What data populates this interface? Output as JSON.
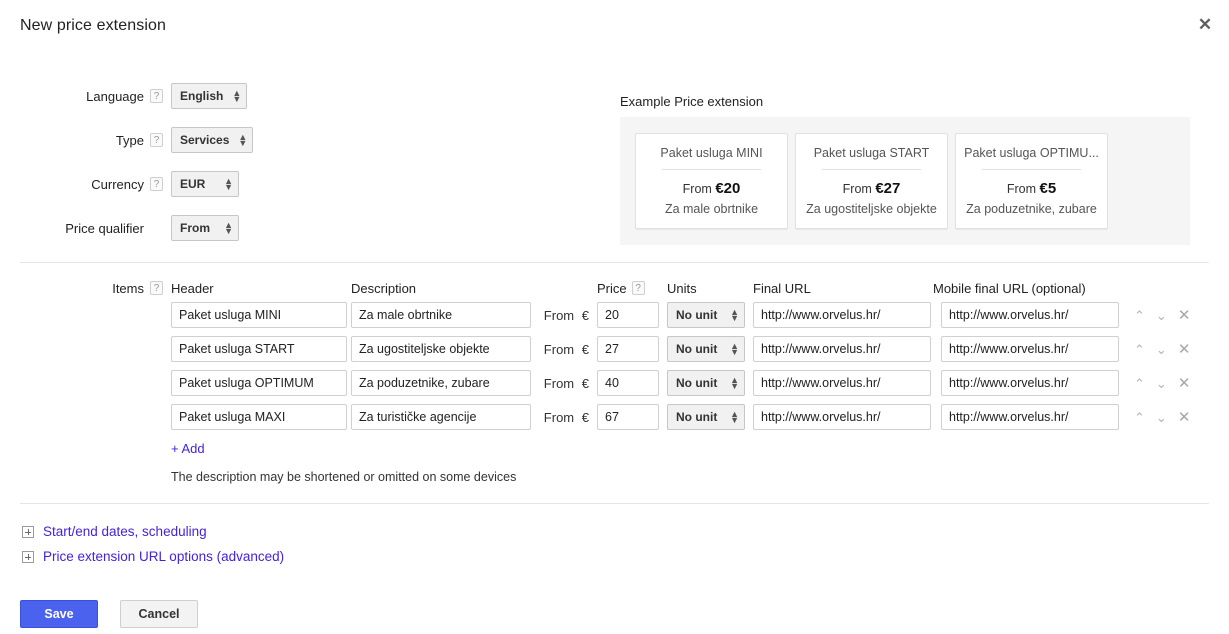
{
  "dialog": {
    "title": "New price extension",
    "close_icon": "close-icon",
    "close_glyph": "✕"
  },
  "form": {
    "rows": [
      {
        "label": "Language",
        "help": "?",
        "value": "English",
        "has_help": true
      },
      {
        "label": "Type",
        "help": "?",
        "value": "Services",
        "has_help": true
      },
      {
        "label": "Currency",
        "help": "?",
        "value": "EUR",
        "has_help": true
      },
      {
        "label": "Price qualifier",
        "help": "",
        "value": "From",
        "has_help": false
      }
    ]
  },
  "example": {
    "title": "Example Price extension",
    "cards": [
      {
        "header": "Paket usluga MINI",
        "qualifier": "From",
        "price": "€20",
        "desc": "Za male obrtnike"
      },
      {
        "header": "Paket usluga START",
        "qualifier": "From",
        "price": "€27",
        "desc": "Za ugostiteljske objekte"
      },
      {
        "header": "Paket usluga OPTIMU...",
        "qualifier": "From",
        "price": "€5",
        "desc": "Za poduzetnike, zubare"
      }
    ]
  },
  "items": {
    "label": "Items",
    "help": "?",
    "columns": {
      "header": "Header",
      "description": "Description",
      "price": "Price",
      "price_help": "?",
      "units": "Units",
      "final_url": "Final URL",
      "mobile_final_url": "Mobile final URL (optional)"
    },
    "rows": [
      {
        "header": "Paket usluga MINI",
        "description": "Za male obrtnike",
        "qualifier": "From",
        "currency": "€",
        "price": "20",
        "units": "No unit",
        "final_url": "http://www.orvelus.hr/",
        "mobile_final_url": "http://www.orvelus.hr/",
        "move_up_icon": "chevron-up-icon",
        "move_down_icon": "chevron-down-icon",
        "delete_icon": "close-icon"
      },
      {
        "header": "Paket usluga START",
        "description": "Za ugostiteljske objekte",
        "qualifier": "From",
        "currency": "€",
        "price": "27",
        "units": "No unit",
        "final_url": "http://www.orvelus.hr/",
        "mobile_final_url": "http://www.orvelus.hr/",
        "move_up_icon": "chevron-up-icon",
        "move_down_icon": "chevron-down-icon",
        "delete_icon": "close-icon"
      },
      {
        "header": "Paket usluga OPTIMUM",
        "description": "Za poduzetnike, zubare",
        "qualifier": "From",
        "currency": "€",
        "price": "40",
        "units": "No unit",
        "final_url": "http://www.orvelus.hr/",
        "mobile_final_url": "http://www.orvelus.hr/",
        "move_up_icon": "chevron-up-icon",
        "move_down_icon": "chevron-down-icon",
        "delete_icon": "close-icon"
      },
      {
        "header": "Paket usluga MAXI",
        "description": "Za turističke agencije",
        "qualifier": "From",
        "currency": "€",
        "price": "67",
        "units": "No unit",
        "final_url": "http://www.orvelus.hr/",
        "mobile_final_url": "http://www.orvelus.hr/",
        "move_up_icon": "chevron-up-icon",
        "move_down_icon": "chevron-down-icon",
        "delete_icon": "close-icon"
      }
    ],
    "add_label": "+ Add",
    "hint": "The description may be shortened or omitted on some devices"
  },
  "expanders": [
    {
      "label": "Start/end dates, scheduling",
      "icon": "plus-box-icon"
    },
    {
      "label": "Price extension URL options (advanced)",
      "icon": "plus-box-icon"
    }
  ],
  "footer": {
    "save_label": "Save",
    "cancel_label": "Cancel"
  },
  "colors": {
    "primary": "#4b62ef",
    "link": "#4422dd",
    "panel_bg": "#f5f5f5",
    "border": "#d0d0d0"
  }
}
